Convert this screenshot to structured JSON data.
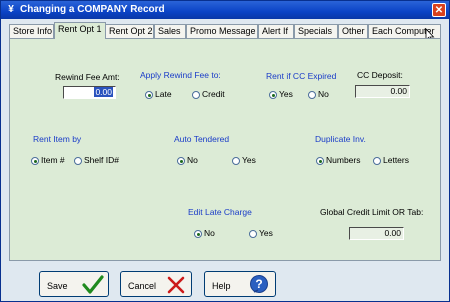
{
  "window": {
    "title": "Changing a COMPANY Record",
    "close_glyph": "✕",
    "app_glyph": "¥"
  },
  "tabs": [
    {
      "label": "Store Info",
      "active": false
    },
    {
      "label": "Rent Opt 1",
      "active": true
    },
    {
      "label": "Rent Opt 2",
      "active": false
    },
    {
      "label": "Sales",
      "active": false
    },
    {
      "label": "Promo Message",
      "active": false
    },
    {
      "label": "Alert If",
      "active": false
    },
    {
      "label": "Specials",
      "active": false
    },
    {
      "label": "Other",
      "active": false
    },
    {
      "label": "Each Computer",
      "active": false
    }
  ],
  "panel": {
    "rewind_fee": {
      "label": "Rewind Fee Amt:",
      "value": "0.00"
    },
    "apply_rewind": {
      "label": "Apply Rewind Fee to:",
      "options": [
        "Late",
        "Credit"
      ],
      "selected": "Late"
    },
    "rent_if_cc": {
      "label": "Rent if  CC Expired",
      "options": [
        "Yes",
        "No"
      ],
      "selected": "Yes"
    },
    "cc_deposit": {
      "label": "CC Deposit:",
      "value": "0.00"
    },
    "rent_item_by": {
      "label": "Rent Item by",
      "options": [
        "Item #",
        "Shelf ID#"
      ],
      "selected": "Item #"
    },
    "auto_tendered": {
      "label": "Auto Tendered",
      "options": [
        "No",
        "Yes"
      ],
      "selected": "No"
    },
    "duplicate_inv": {
      "label": "Duplicate Inv.",
      "options": [
        "Numbers",
        "Letters"
      ],
      "selected": "Numbers"
    },
    "edit_late_charge": {
      "label": "Edit Late Charge",
      "options": [
        "No",
        "Yes"
      ],
      "selected": "No"
    },
    "global_credit": {
      "label": "Global Credit Limit OR Tab:",
      "value": "0.00"
    }
  },
  "buttons": {
    "save": "Save",
    "cancel": "Cancel",
    "help": "Help"
  },
  "colors": {
    "title_bar": "#0b43c6",
    "panel_bg": "#dcebd6",
    "group_label": "#1a3cc8",
    "save_check": "#1f8a1f",
    "cancel_x": "#cc1a1a",
    "help_icon": "#2a5fc0"
  }
}
